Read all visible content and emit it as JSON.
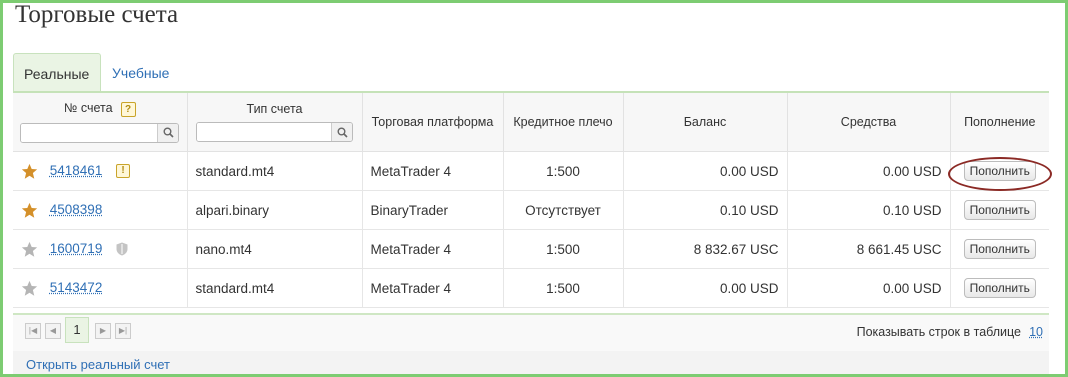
{
  "page": {
    "title": "Торговые счета"
  },
  "tabs": [
    {
      "label": "Реальные",
      "active": true
    },
    {
      "label": "Учебные",
      "active": false
    }
  ],
  "table": {
    "headers": {
      "account_no": "№ счета",
      "account_type": "Тип счета",
      "platform": "Торговая платформа",
      "leverage": "Кредитное плечо",
      "balance": "Баланс",
      "equity": "Средства",
      "topup": "Пополнение"
    },
    "help_symbol": "?",
    "rows": [
      {
        "star": "filled",
        "account": "5418461",
        "badge": "warning",
        "type": "standard.mt4",
        "platform": "MetaTrader 4",
        "leverage": "1:500",
        "balance": "0.00 USD",
        "equity": "0.00 USD",
        "topup": "Пополнить"
      },
      {
        "star": "filled",
        "account": "4508398",
        "badge": "",
        "type": "alpari.binary",
        "platform": "BinaryTrader",
        "leverage": "Отсутствует",
        "balance": "0.10 USD",
        "equity": "0.10 USD",
        "topup": "Пополнить"
      },
      {
        "star": "empty",
        "account": "1600719",
        "badge": "shield",
        "type": "nano.mt4",
        "platform": "MetaTrader 4",
        "leverage": "1:500",
        "balance": "8 832.67 USC",
        "equity": "8 661.45 USC",
        "topup": "Пополнить"
      },
      {
        "star": "empty",
        "account": "5143472",
        "badge": "",
        "type": "standard.mt4",
        "platform": "MetaTrader 4",
        "leverage": "1:500",
        "balance": "0.00 USD",
        "equity": "0.00 USD",
        "topup": "Пополнить"
      }
    ]
  },
  "pager": {
    "current_page": "1",
    "rows_label": "Показывать строк в таблице",
    "rows_value": "10"
  },
  "footer": {
    "open_account": "Открыть реальный счет"
  },
  "colors": {
    "accent_green": "#7dcc72",
    "link_blue": "#2f6fb5",
    "star_gold": "#d4902a",
    "star_grey": "#b5b5b5",
    "highlight": "#8b2a25"
  }
}
